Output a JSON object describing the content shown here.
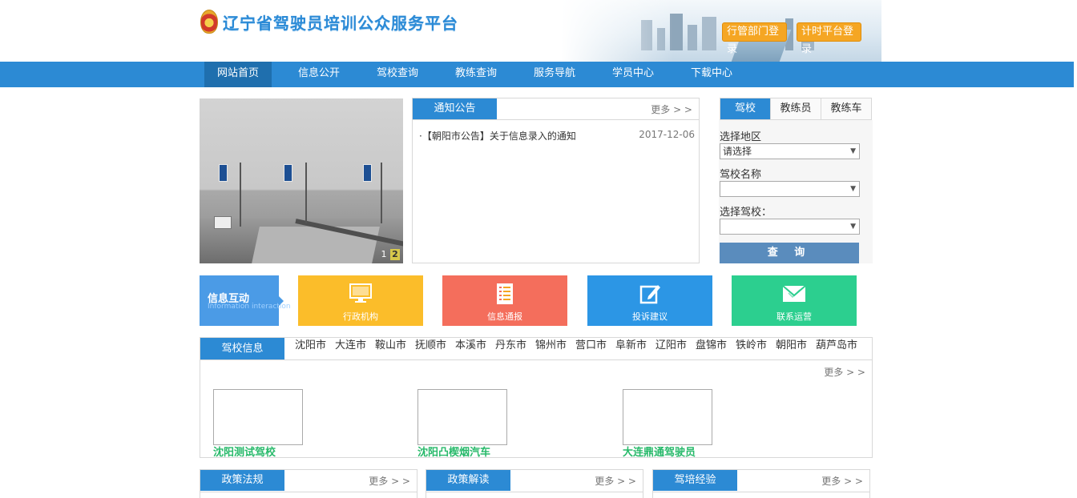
{
  "header": {
    "site_title": "辽宁省驾驶员培训公众服务平台",
    "login_admin": "行管部门登录",
    "login_timer": "计时平台登录"
  },
  "nav": {
    "items": [
      "网站首页",
      "信息公开",
      "驾校查询",
      "教练查询",
      "服务导航",
      "学员中心",
      "下载中心"
    ],
    "active_index": 0
  },
  "slideshow": {
    "pages": [
      "1",
      "2"
    ],
    "current": "2"
  },
  "notice": {
    "tab": "通知公告",
    "more": "更多 > >",
    "items": [
      {
        "bullet": "·",
        "title": "【朝阳市公告】关于信息录入的通知",
        "date": "2017-12-06"
      }
    ]
  },
  "search": {
    "tabs": [
      "驾校",
      "教练员",
      "教练车"
    ],
    "active_tab": "驾校",
    "region_label": "选择地区",
    "region_value": "请选择",
    "name_label": "驾校名称",
    "name_value": "",
    "school_label": "选择驾校：",
    "school_value": "",
    "submit": "查 询"
  },
  "interaction": {
    "label_cn": "信息互动",
    "label_en": "Information interaction",
    "tiles": [
      {
        "label": "行政机构",
        "icon": "monitor-icon",
        "color": "#fbbd2a"
      },
      {
        "label": "信息通报",
        "icon": "document-list-icon",
        "color": "#f46e5c"
      },
      {
        "label": "投诉建议",
        "icon": "edit-icon",
        "color": "#2c96e5"
      },
      {
        "label": "联系运营",
        "icon": "envelope-icon",
        "color": "#2ccf8f"
      }
    ]
  },
  "school_info": {
    "tab": "驾校信息",
    "cities": [
      "沈阳市",
      "大连市",
      "鞍山市",
      "抚顺市",
      "本溪市",
      "丹东市",
      "锦州市",
      "营口市",
      "阜新市",
      "辽阳市",
      "盘锦市",
      "铁岭市",
      "朝阳市",
      "葫芦岛市"
    ],
    "more": "更多 > >",
    "schools": [
      "沈阳测试驾校",
      "沈阳凸楔烟汽车",
      "大连鼎通驾驶员"
    ]
  },
  "bottom_panels": [
    {
      "tab": "政策法规",
      "more": "更多 > >"
    },
    {
      "tab": "政策解读",
      "more": "更多 > >"
    },
    {
      "tab": "驾培经验",
      "more": "更多 > >"
    }
  ]
}
